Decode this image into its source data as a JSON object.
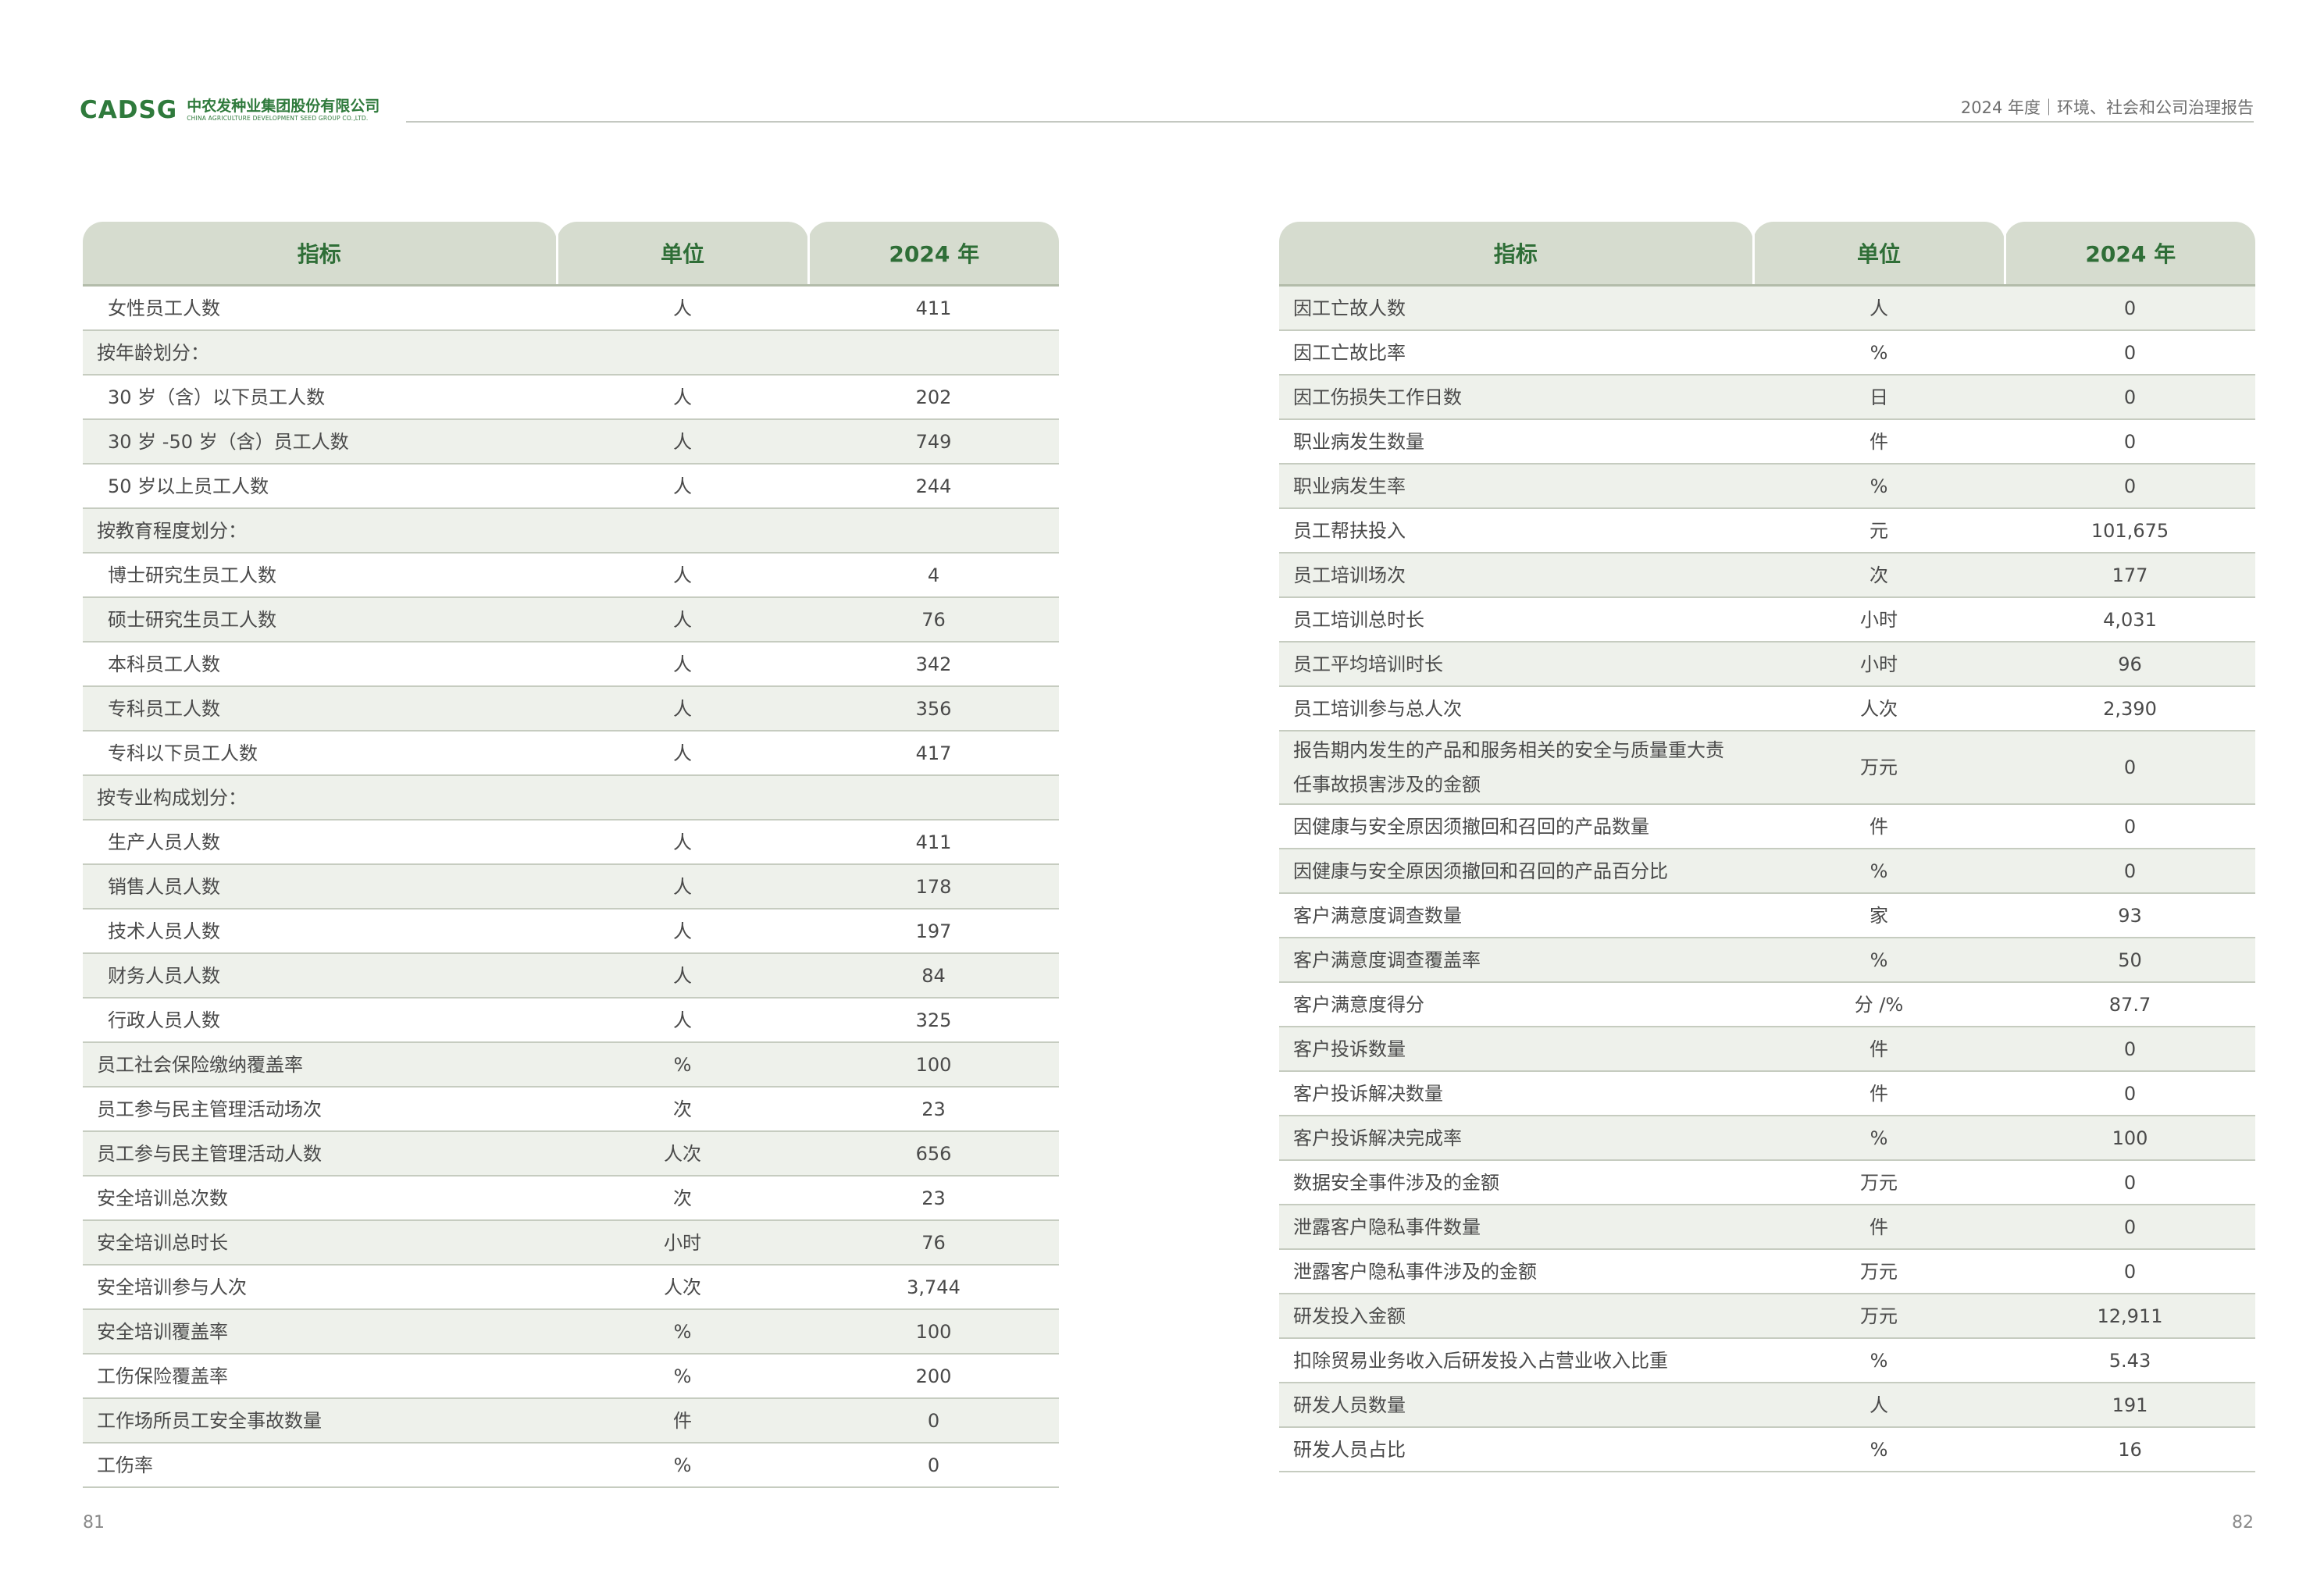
{
  "header": {
    "logo_mark": "CADSG",
    "logo_cn": "中农发种业集团股份有限公司",
    "logo_en": "CHINA AGRICULTURE DEVELOPMENT SEED GROUP CO.,LTD.",
    "title": "2024 年度｜环境、社会和公司治理报告"
  },
  "columns": {
    "indicator": "指标",
    "unit": "单位",
    "year": "2024 年"
  },
  "left_rows": [
    {
      "indicator": "女性员工人数",
      "unit": "人",
      "value": "411"
    },
    {
      "indicator": "按年龄划分：",
      "unit": "",
      "value": ""
    },
    {
      "indicator": "30 岁（含）以下员工人数",
      "unit": "人",
      "value": "202"
    },
    {
      "indicator": "30 岁 -50 岁（含）员工人数",
      "unit": "人",
      "value": "749"
    },
    {
      "indicator": "50 岁以上员工人数",
      "unit": "人",
      "value": "244"
    },
    {
      "indicator": "按教育程度划分：",
      "unit": "",
      "value": ""
    },
    {
      "indicator": "博士研究生员工人数",
      "unit": "人",
      "value": "4"
    },
    {
      "indicator": "硕士研究生员工人数",
      "unit": "人",
      "value": "76"
    },
    {
      "indicator": "本科员工人数",
      "unit": "人",
      "value": "342"
    },
    {
      "indicator": "专科员工人数",
      "unit": "人",
      "value": "356"
    },
    {
      "indicator": "专科以下员工人数",
      "unit": "人",
      "value": "417"
    },
    {
      "indicator": "按专业构成划分：",
      "unit": "",
      "value": ""
    },
    {
      "indicator": "生产人员人数",
      "unit": "人",
      "value": "411"
    },
    {
      "indicator": "销售人员人数",
      "unit": "人",
      "value": "178"
    },
    {
      "indicator": "技术人员人数",
      "unit": "人",
      "value": "197"
    },
    {
      "indicator": "财务人员人数",
      "unit": "人",
      "value": "84"
    },
    {
      "indicator": "行政人员人数",
      "unit": "人",
      "value": "325"
    },
    {
      "indicator": "员工社会保险缴纳覆盖率",
      "unit": "%",
      "value": "100"
    },
    {
      "indicator": "员工参与民主管理活动场次",
      "unit": "次",
      "value": "23"
    },
    {
      "indicator": "员工参与民主管理活动人数",
      "unit": "人次",
      "value": "656"
    },
    {
      "indicator": "安全培训总次数",
      "unit": "次",
      "value": "23"
    },
    {
      "indicator": "安全培训总时长",
      "unit": "小时",
      "value": "76"
    },
    {
      "indicator": "安全培训参与人次",
      "unit": "人次",
      "value": "3,744"
    },
    {
      "indicator": "安全培训覆盖率",
      "unit": "%",
      "value": "100"
    },
    {
      "indicator": "工伤保险覆盖率",
      "unit": "%",
      "value": "200"
    },
    {
      "indicator": "工作场所员工安全事故数量",
      "unit": "件",
      "value": "0"
    },
    {
      "indicator": "工伤率",
      "unit": "%",
      "value": "0"
    }
  ],
  "right_rows": [
    {
      "indicator": "因工亡故人数",
      "unit": "人",
      "value": "0"
    },
    {
      "indicator": "因工亡故比率",
      "unit": "%",
      "value": "0"
    },
    {
      "indicator": "因工伤损失工作日数",
      "unit": "日",
      "value": "0"
    },
    {
      "indicator": "职业病发生数量",
      "unit": "件",
      "value": "0"
    },
    {
      "indicator": "职业病发生率",
      "unit": "%",
      "value": "0"
    },
    {
      "indicator": "员工帮扶投入",
      "unit": "元",
      "value": "101,675"
    },
    {
      "indicator": "员工培训场次",
      "unit": "次",
      "value": "177"
    },
    {
      "indicator": "员工培训总时长",
      "unit": "小时",
      "value": "4,031"
    },
    {
      "indicator": "员工平均培训时长",
      "unit": "小时",
      "value": "96"
    },
    {
      "indicator": "员工培训参与总人次",
      "unit": "人次",
      "value": "2,390"
    },
    {
      "indicator_line1": "报告期内发生的产品和服务相关的安全与质量重大责",
      "indicator_line2": "任事故损害涉及的金额",
      "unit": "万元",
      "value": "0"
    },
    {
      "indicator": "因健康与安全原因须撤回和召回的产品数量",
      "unit": "件",
      "value": "0"
    },
    {
      "indicator": "因健康与安全原因须撤回和召回的产品百分比",
      "unit": "%",
      "value": "0"
    },
    {
      "indicator": "客户满意度调查数量",
      "unit": "家",
      "value": "93"
    },
    {
      "indicator": "客户满意度调查覆盖率",
      "unit": "%",
      "value": "50"
    },
    {
      "indicator": "客户满意度得分",
      "unit": "分 /%",
      "value": "87.7"
    },
    {
      "indicator": "客户投诉数量",
      "unit": "件",
      "value": "0"
    },
    {
      "indicator": "客户投诉解决数量",
      "unit": "件",
      "value": "0"
    },
    {
      "indicator": "客户投诉解决完成率",
      "unit": "%",
      "value": "100"
    },
    {
      "indicator": "数据安全事件涉及的金额",
      "unit": "万元",
      "value": "0"
    },
    {
      "indicator": "泄露客户隐私事件数量",
      "unit": "件",
      "value": "0"
    },
    {
      "indicator": "泄露客户隐私事件涉及的金额",
      "unit": "万元",
      "value": "0"
    },
    {
      "indicator": "研发投入金额",
      "unit": "万元",
      "value": "12,911"
    },
    {
      "indicator": "扣除贸易业务收入后研发投入占营业收入比重",
      "unit": "%",
      "value": "5.43"
    },
    {
      "indicator": "研发人员数量",
      "unit": "人",
      "value": "191"
    },
    {
      "indicator": "研发人员占比",
      "unit": "%",
      "value": "16"
    }
  ],
  "footer": {
    "left_page": "81",
    "right_page": "82"
  }
}
